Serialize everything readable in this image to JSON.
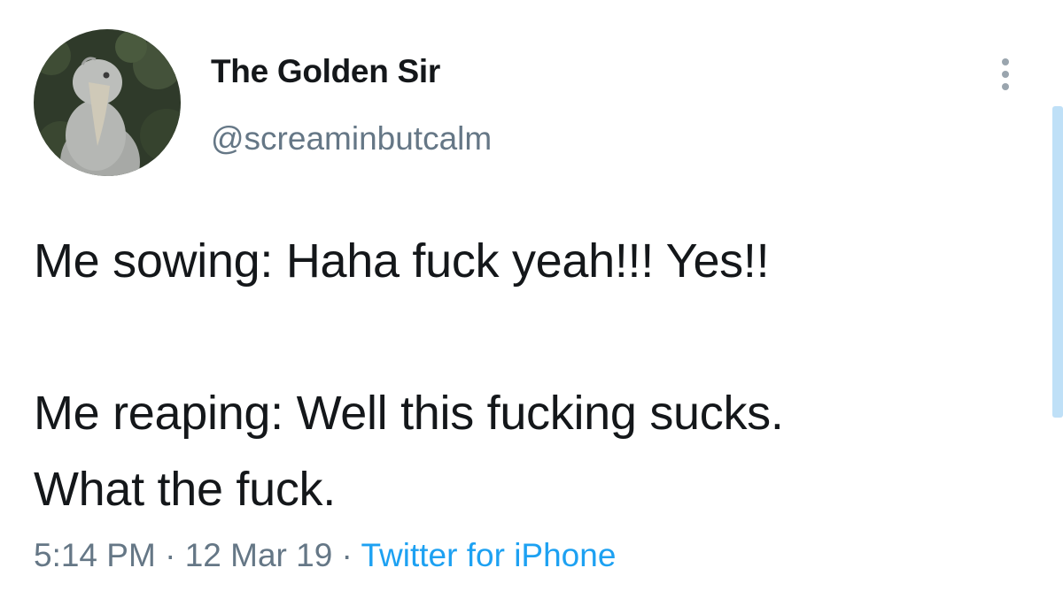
{
  "user": {
    "display_name": "The Golden Sir",
    "handle": "@screaminbutcalm",
    "avatar_icon": "shoebill-bird-avatar"
  },
  "tweet": {
    "line1": "Me sowing: Haha fuck yeah!!! Yes!!",
    "line2": "Me reaping: Well this fucking sucks.",
    "line3": "What the fuck."
  },
  "meta": {
    "time": "5:14 PM",
    "sep1": " · ",
    "date": "12 Mar 19",
    "sep2": " · ",
    "source": "Twitter for iPhone"
  },
  "icons": {
    "more": "more-vertical-icon"
  },
  "colors": {
    "text": "#14171a",
    "secondary": "#657786",
    "link": "#1da1f2",
    "scrollbar": "#bfe0f7"
  }
}
